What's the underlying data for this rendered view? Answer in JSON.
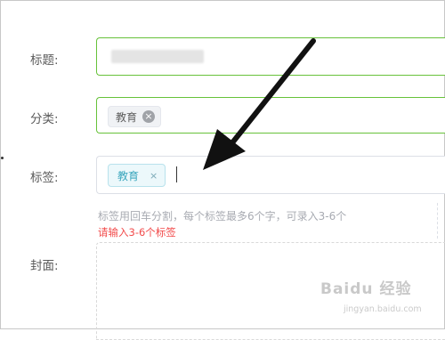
{
  "form": {
    "title_label": "标题:",
    "category_label": "分类:",
    "tags_label": "标签:",
    "cover_label": "封面:",
    "category_chip": "教育",
    "tag_chip": "教育",
    "chip_close_symbol": "×",
    "tags_hint": "标签用回车分割，每个标签最多6个字，可录入3-6个",
    "tags_error": "请输入3-6个标签"
  },
  "watermark": {
    "brand": "Baidu 经验",
    "url": "jingyan.baidu.com"
  },
  "colors": {
    "focus_border": "#67c23a",
    "default_border": "#dcdfe6",
    "tag_text": "#3aa6bd",
    "error_text": "#f24a4a"
  }
}
